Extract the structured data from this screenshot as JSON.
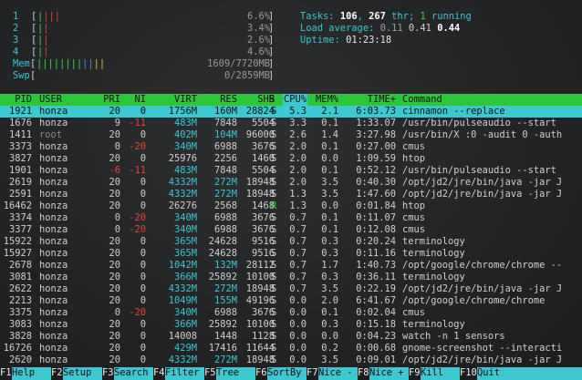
{
  "meters": {
    "cpu": [
      {
        "label": "1",
        "bars": "||||",
        "pct": "6.6%"
      },
      {
        "label": "2",
        "bars": "||",
        "pct": "3.4%"
      },
      {
        "label": "3",
        "bars": "||",
        "pct": "2.6%"
      },
      {
        "label": "4",
        "bars": "||",
        "pct": "4.6%"
      }
    ],
    "mem": {
      "label": "Mem",
      "bars": "||||||||||||",
      "value": "1609/7720MB"
    },
    "swp": {
      "label": "Swp",
      "bars": "",
      "value": "0/2859MB"
    }
  },
  "stats": {
    "tasks_label": "Tasks:",
    "tasks": "106",
    "sep": ",",
    "threads": "267",
    "thr_label": "thr;",
    "running": "1",
    "running_label": "running",
    "load_label": "Load average:",
    "load1": "0.11",
    "load5": "0.41",
    "load15": "0.44",
    "uptime_label": "Uptime:",
    "uptime": "01:23:18"
  },
  "columns": [
    "PID",
    "USER",
    "PRI",
    "NI",
    "VIRT",
    "RES",
    "SHR",
    "S",
    "CPU%",
    "MEM%",
    "TIME+",
    "Command"
  ],
  "processes": [
    {
      "pid": "1921",
      "user": "honza",
      "pri": "20",
      "ni": "0",
      "virt": "1756M",
      "res": "160M",
      "shr": "28824",
      "s": "S",
      "cpu": "5.3",
      "mem": "2.1",
      "time": "6:03.73",
      "cmd": "cinnamon --replace"
    },
    {
      "pid": "1676",
      "user": "honza",
      "pri": "9",
      "ni": "-11",
      "virt": "483M",
      "res": "7848",
      "shr": "5504",
      "s": "S",
      "cpu": "3.3",
      "mem": "0.1",
      "time": "1:33.07",
      "cmd": "/usr/bin/pulseaudio --start"
    },
    {
      "pid": "1411",
      "user": "root",
      "pri": "20",
      "ni": "0",
      "virt": "402M",
      "res": "104M",
      "shr": "96000",
      "s": "S",
      "cpu": "2.6",
      "mem": "1.4",
      "time": "3:27.98",
      "cmd": "/usr/bin/X :0 -audit 0 -auth"
    },
    {
      "pid": "3373",
      "user": "honza",
      "pri": "0",
      "ni": "-20",
      "virt": "340M",
      "res": "6988",
      "shr": "3676",
      "s": "S",
      "cpu": "2.0",
      "mem": "0.1",
      "time": "0:27.00",
      "cmd": "cmus"
    },
    {
      "pid": "3827",
      "user": "honza",
      "pri": "20",
      "ni": "0",
      "virt": "25976",
      "res": "2256",
      "shr": "1460",
      "s": "S",
      "cpu": "2.0",
      "mem": "0.0",
      "time": "1:09.59",
      "cmd": "htop"
    },
    {
      "pid": "1901",
      "user": "honza",
      "pri": "-6",
      "ni": "-11",
      "virt": "483M",
      "res": "7848",
      "shr": "5504",
      "s": "S",
      "cpu": "2.0",
      "mem": "0.1",
      "time": "0:52.12",
      "cmd": "/usr/bin/pulseaudio --start"
    },
    {
      "pid": "2619",
      "user": "honza",
      "pri": "20",
      "ni": "0",
      "virt": "4332M",
      "res": "272M",
      "shr": "18948",
      "s": "S",
      "cpu": "2.0",
      "mem": "3.5",
      "time": "0:40.30",
      "cmd": "/opt/jd2/jre/bin/java -jar J"
    },
    {
      "pid": "2591",
      "user": "honza",
      "pri": "20",
      "ni": "0",
      "virt": "4332M",
      "res": "272M",
      "shr": "18948",
      "s": "S",
      "cpu": "1.3",
      "mem": "3.5",
      "time": "1:47.60",
      "cmd": "/opt/jd2/jre/bin/java -jar J"
    },
    {
      "pid": "16462",
      "user": "honza",
      "pri": "20",
      "ni": "0",
      "virt": "26276",
      "res": "2568",
      "shr": "1468",
      "s": "R",
      "cpu": "1.3",
      "mem": "0.0",
      "time": "0:01.84",
      "cmd": "htop"
    },
    {
      "pid": "3374",
      "user": "honza",
      "pri": "0",
      "ni": "-20",
      "virt": "340M",
      "res": "6988",
      "shr": "3676",
      "s": "S",
      "cpu": "0.7",
      "mem": "0.1",
      "time": "0:11.07",
      "cmd": "cmus"
    },
    {
      "pid": "3377",
      "user": "honza",
      "pri": "0",
      "ni": "-20",
      "virt": "340M",
      "res": "6988",
      "shr": "3676",
      "s": "S",
      "cpu": "0.7",
      "mem": "0.1",
      "time": "0:12.08",
      "cmd": "cmus"
    },
    {
      "pid": "15922",
      "user": "honza",
      "pri": "20",
      "ni": "0",
      "virt": "365M",
      "res": "24628",
      "shr": "9516",
      "s": "S",
      "cpu": "0.7",
      "mem": "0.3",
      "time": "0:20.24",
      "cmd": "terminology"
    },
    {
      "pid": "15927",
      "user": "honza",
      "pri": "20",
      "ni": "0",
      "virt": "365M",
      "res": "24628",
      "shr": "9516",
      "s": "S",
      "cpu": "0.7",
      "mem": "0.3",
      "time": "0:11.16",
      "cmd": "terminology"
    },
    {
      "pid": "2678",
      "user": "honza",
      "pri": "20",
      "ni": "0",
      "virt": "1042M",
      "res": "132M",
      "shr": "28112",
      "s": "S",
      "cpu": "0.7",
      "mem": "1.7",
      "time": "1:40.73",
      "cmd": "/opt/google/chrome/chrome --"
    },
    {
      "pid": "3081",
      "user": "honza",
      "pri": "20",
      "ni": "0",
      "virt": "366M",
      "res": "25892",
      "shr": "10100",
      "s": "S",
      "cpu": "0.7",
      "mem": "0.3",
      "time": "0:36.11",
      "cmd": "terminology"
    },
    {
      "pid": "2622",
      "user": "honza",
      "pri": "20",
      "ni": "0",
      "virt": "4332M",
      "res": "272M",
      "shr": "18948",
      "s": "S",
      "cpu": "0.7",
      "mem": "3.5",
      "time": "0:22.19",
      "cmd": "/opt/jd2/jre/bin/java -jar J"
    },
    {
      "pid": "2213",
      "user": "honza",
      "pri": "20",
      "ni": "0",
      "virt": "1049M",
      "res": "155M",
      "shr": "49196",
      "s": "S",
      "cpu": "0.0",
      "mem": "2.0",
      "time": "6:41.67",
      "cmd": "/opt/google/chrome/chrome"
    },
    {
      "pid": "3375",
      "user": "honza",
      "pri": "0",
      "ni": "-20",
      "virt": "340M",
      "res": "6988",
      "shr": "3676",
      "s": "S",
      "cpu": "0.0",
      "mem": "0.1",
      "time": "0:02.04",
      "cmd": "cmus"
    },
    {
      "pid": "3083",
      "user": "honza",
      "pri": "20",
      "ni": "0",
      "virt": "366M",
      "res": "25892",
      "shr": "10100",
      "s": "S",
      "cpu": "0.0",
      "mem": "0.3",
      "time": "0:15.18",
      "cmd": "terminology"
    },
    {
      "pid": "3828",
      "user": "honza",
      "pri": "20",
      "ni": "0",
      "virt": "14008",
      "res": "1448",
      "shr": "1128",
      "s": "S",
      "cpu": "0.0",
      "mem": "0.0",
      "time": "0:04.23",
      "cmd": "watch -n 1 sensors"
    },
    {
      "pid": "16726",
      "user": "honza",
      "pri": "20",
      "ni": "0",
      "virt": "429M",
      "res": "17416",
      "shr": "11644",
      "s": "S",
      "cpu": "0.0",
      "mem": "0.2",
      "time": "0:00.68",
      "cmd": "gnome-screenshot --interacti"
    },
    {
      "pid": "2620",
      "user": "honza",
      "pri": "20",
      "ni": "0",
      "virt": "4332M",
      "res": "272M",
      "shr": "18948",
      "s": "S",
      "cpu": "0.0",
      "mem": "3.5",
      "time": "0:09.01",
      "cmd": "/opt/jd2/jre/bin/java -jar J"
    }
  ],
  "footer": [
    {
      "key": "F1",
      "label": "Help"
    },
    {
      "key": "F2",
      "label": "Setup"
    },
    {
      "key": "F3",
      "label": "Search"
    },
    {
      "key": "F4",
      "label": "Filter"
    },
    {
      "key": "F5",
      "label": "Tree"
    },
    {
      "key": "F6",
      "label": "SortBy"
    },
    {
      "key": "F7",
      "label": "Nice -"
    },
    {
      "key": "F8",
      "label": "Nice +"
    },
    {
      "key": "F9",
      "label": "Kill"
    },
    {
      "key": "F10",
      "label": "Quit"
    }
  ]
}
